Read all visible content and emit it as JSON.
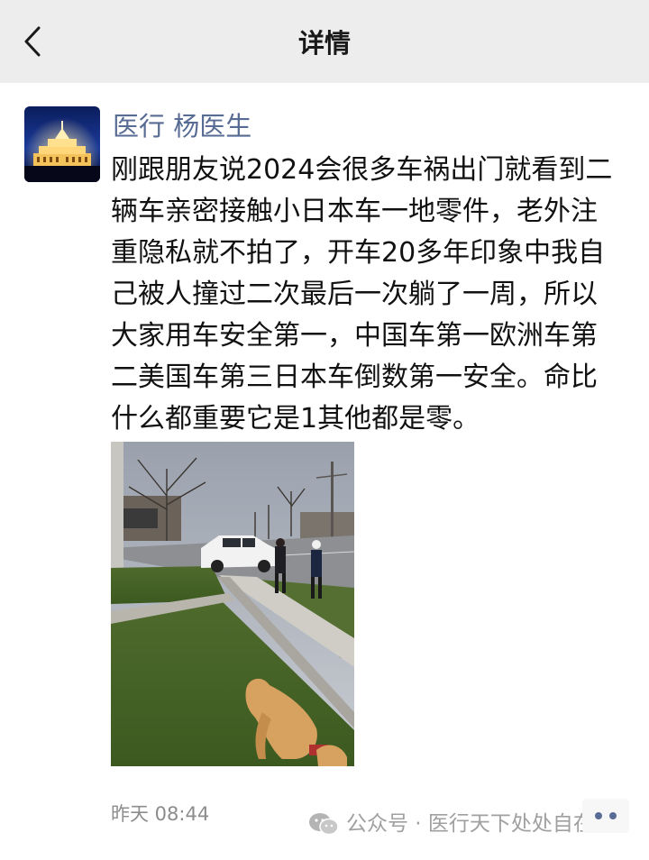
{
  "header": {
    "title": "详情",
    "back_icon": "chevron-left-icon"
  },
  "post": {
    "author": "医行 杨医生",
    "content": "刚跟朋友说2024会很多车祸出门就看到二辆车亲密接触小日本车一地零件，老外注重隐私就不拍了，开车20多年印象中我自己被人撞过二次最后一次躺了一周，所以大家用车安全第一，中国车第一欧洲车第二美国车第三日本车倒数第一安全。命比什么都重要它是1其他都是零。",
    "timestamp": "昨天 08:44"
  },
  "watermark": {
    "icon": "wechat-icon",
    "text": "公众号 · 医行天下处处自在"
  },
  "colors": {
    "topbar_bg": "#ededed",
    "nickname": "#576b95",
    "timestamp": "#8c8c8c",
    "more_dots": "#576b95"
  }
}
